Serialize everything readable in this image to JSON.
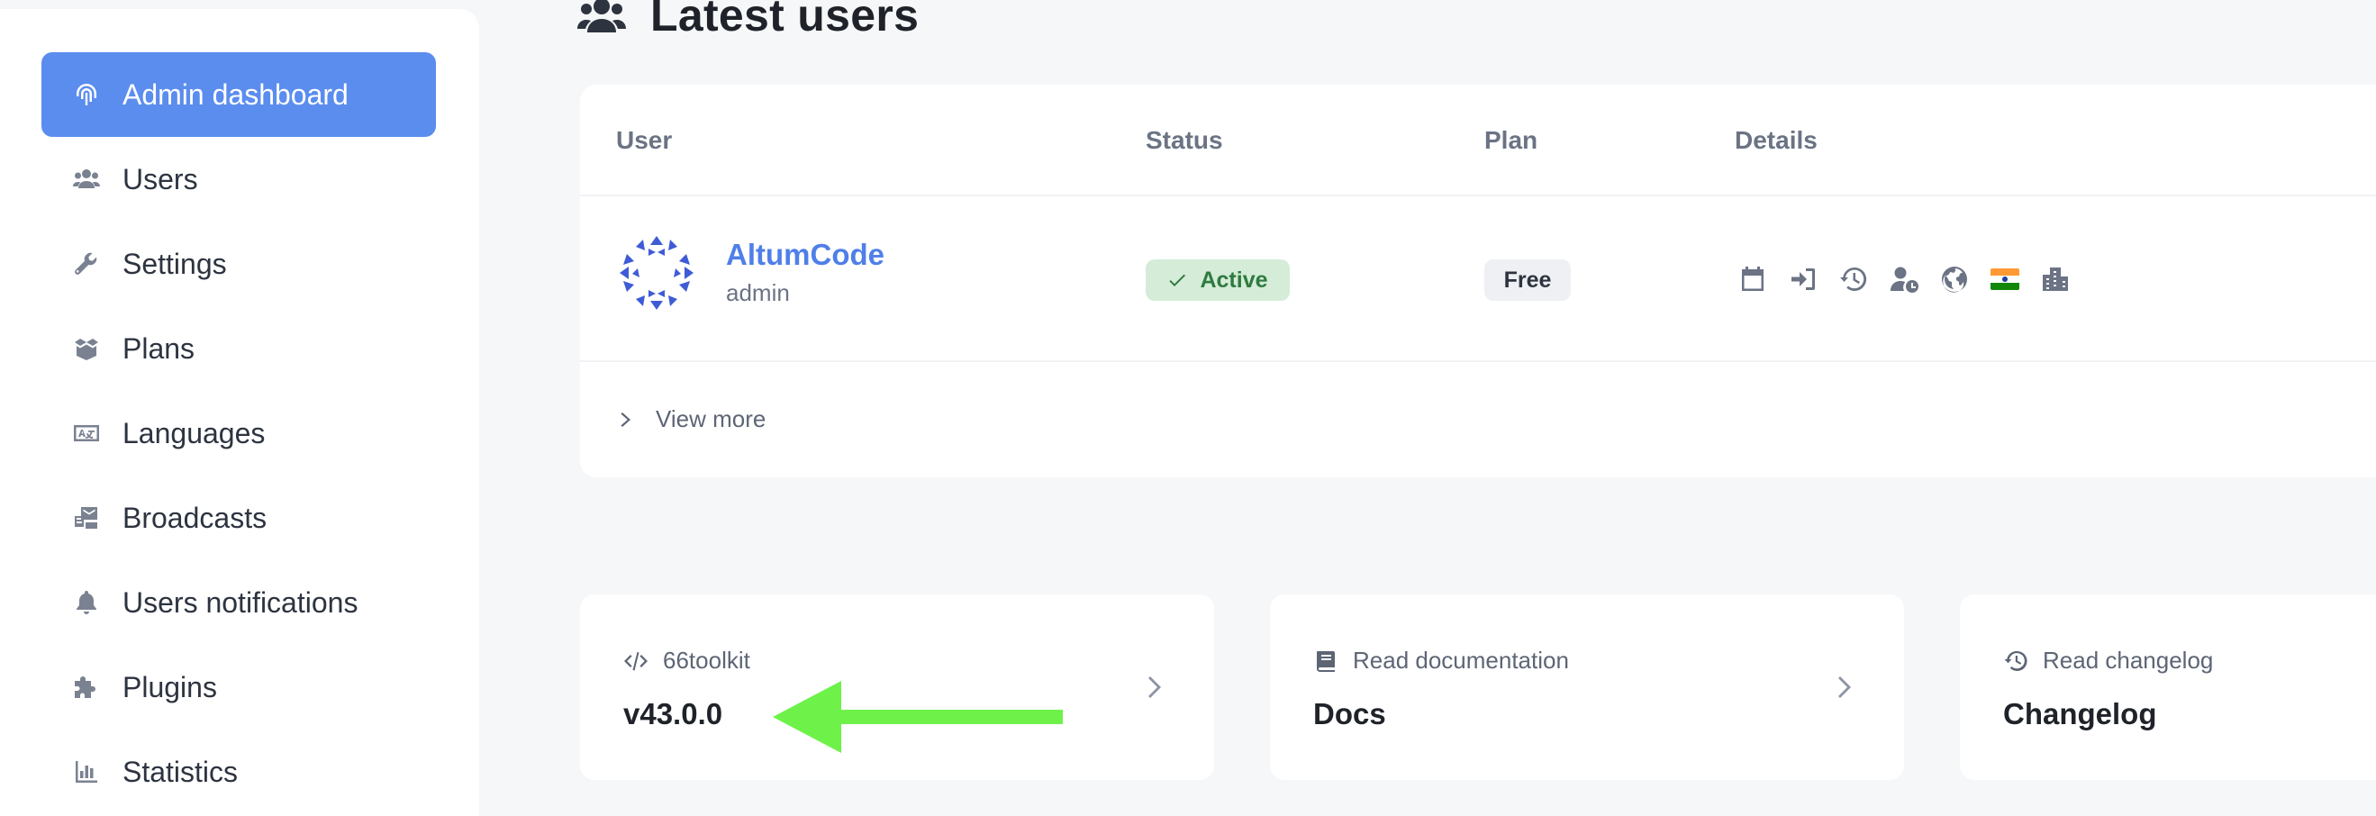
{
  "sidebar": {
    "items": [
      {
        "label": "Admin dashboard",
        "icon": "fingerprint-icon",
        "active": true
      },
      {
        "label": "Users",
        "icon": "users-icon"
      },
      {
        "label": "Settings",
        "icon": "wrench-icon"
      },
      {
        "label": "Plans",
        "icon": "box-icon"
      },
      {
        "label": "Languages",
        "icon": "language-icon"
      },
      {
        "label": "Broadcasts",
        "icon": "broadcast-icon"
      },
      {
        "label": "Users notifications",
        "icon": "bell-icon"
      },
      {
        "label": "Plugins",
        "icon": "puzzle-icon"
      },
      {
        "label": "Statistics",
        "icon": "chart-icon"
      }
    ]
  },
  "header": {
    "title": "Latest users",
    "icon": "users-icon"
  },
  "users_table": {
    "columns": [
      "User",
      "Status",
      "Plan",
      "Details"
    ],
    "rows": [
      {
        "name": "AltumCode",
        "role": "admin",
        "status": "Active",
        "plan": "Free",
        "details_icons": [
          "calendar-icon",
          "sign-in-icon",
          "history-icon",
          "user-clock-icon",
          "globe-icon",
          "india-flag-icon",
          "city-icon"
        ]
      }
    ],
    "view_more": "View more"
  },
  "info_cards": [
    {
      "label": "66toolkit",
      "value": "v43.0.0",
      "icon": "code-icon"
    },
    {
      "label": "Read documentation",
      "value": "Docs",
      "icon": "book-icon"
    },
    {
      "label": "Read changelog",
      "value": "Changelog",
      "icon": "history-icon"
    }
  ],
  "colors": {
    "accent": "#5b8def",
    "link": "#4f7fe8",
    "active_badge_bg": "#d4ecd8",
    "active_badge_text": "#2f7a3f",
    "annotation_arrow": "#6ef24a"
  }
}
